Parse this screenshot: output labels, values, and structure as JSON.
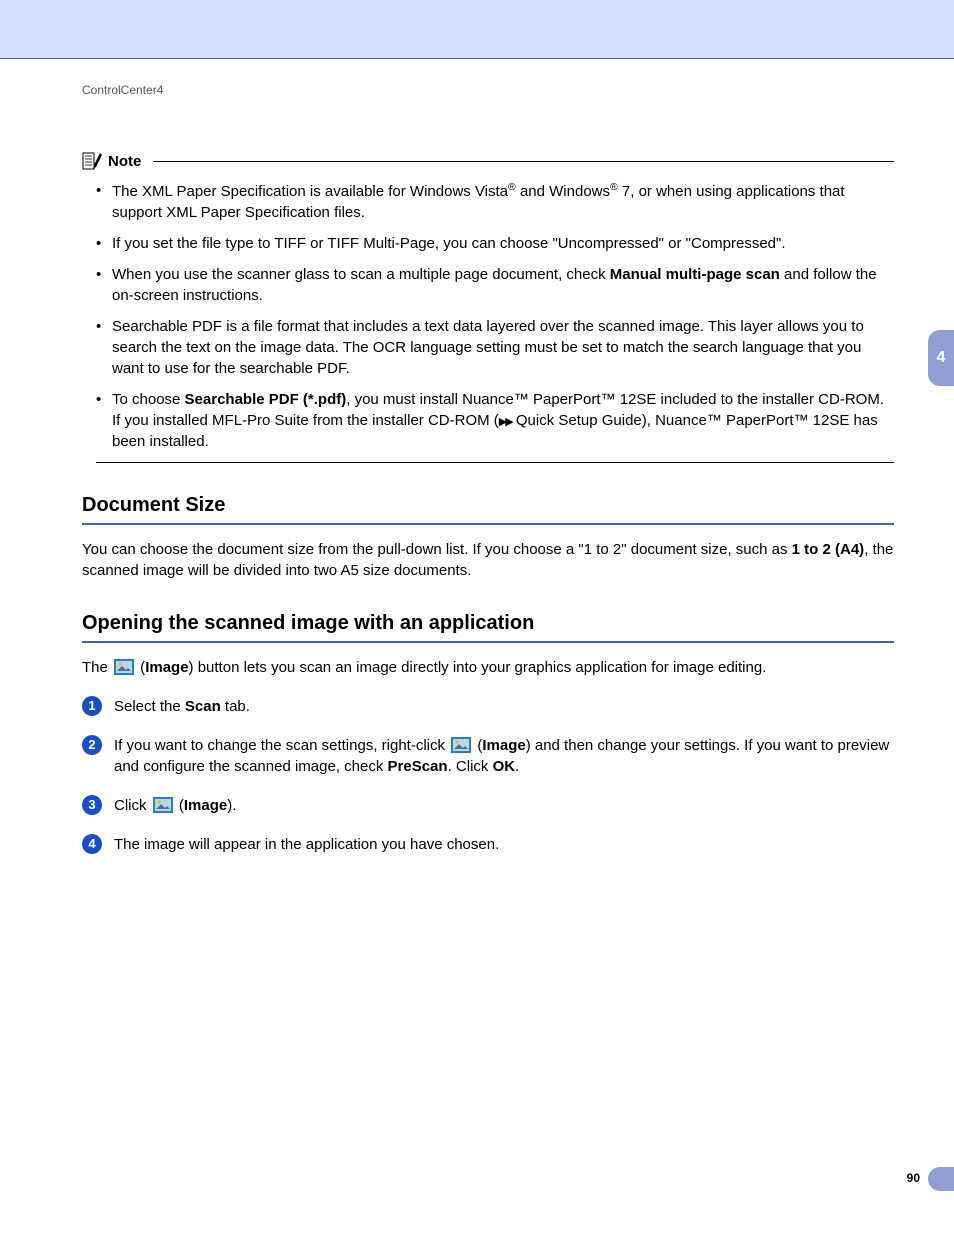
{
  "running_header": "ControlCenter4",
  "side_tab": "4",
  "page_number": "90",
  "note": {
    "label": "Note",
    "items": [
      {
        "parts": [
          "The XML Paper Specification is available for Windows Vista",
          "®",
          " and Windows",
          "®",
          " 7, or when using applications that support XML Paper Specification files."
        ]
      },
      {
        "parts": [
          "If you set the file type to TIFF or TIFF Multi-Page, you can choose \"Uncompressed\" or \"Compressed\"."
        ]
      },
      {
        "parts": [
          "When you use the scanner glass to scan a multiple page document, check ",
          {
            "bold": "Manual multi-page scan"
          },
          " and follow the on-screen instructions."
        ]
      },
      {
        "parts": [
          "Searchable PDF is a file format that includes a text data layered over the scanned image. This layer allows you to search the text on the image data. The OCR language setting must be set to match the search language that you want to use for the searchable PDF."
        ]
      },
      {
        "parts": [
          "To choose ",
          {
            "bold": "Searchable PDF (*.pdf)"
          },
          ", you must install  Nuance™ PaperPort™ 12SE included to the installer CD-ROM. If you installed MFL-Pro Suite from the installer CD-ROM (",
          {
            "arrows": true
          },
          " Quick Setup Guide), Nuance™ PaperPort™ 12SE has been installed."
        ]
      }
    ]
  },
  "section1": {
    "title": "Document Size",
    "paragraph_parts": [
      "You can choose the document size from the pull-down list. If you choose a \"1 to 2\" document size, such as ",
      {
        "bold": "1 to 2 (A4)"
      },
      ", the scanned image will be divided into two A5 size documents."
    ]
  },
  "section2": {
    "title": "Opening the scanned image with an application",
    "intro_parts": [
      "The ",
      {
        "icon": true
      },
      " (",
      {
        "bold": "Image"
      },
      ") button lets you scan an image directly into your graphics application for image editing."
    ],
    "steps": [
      {
        "num": "1",
        "parts": [
          "Select the ",
          {
            "bold": "Scan"
          },
          " tab."
        ]
      },
      {
        "num": "2",
        "parts": [
          "If you want to change the scan settings, right-click ",
          {
            "icon": true
          },
          " (",
          {
            "bold": "Image"
          },
          ") and then change your settings. If you want to preview and configure the scanned image, check ",
          {
            "bold": "PreScan"
          },
          ". Click ",
          {
            "bold": "OK"
          },
          "."
        ]
      },
      {
        "num": "3",
        "parts": [
          "Click ",
          {
            "icon": true
          },
          " (",
          {
            "bold": "Image"
          },
          ")."
        ]
      },
      {
        "num": "4",
        "parts": [
          "The image will appear in the application you have chosen."
        ]
      }
    ]
  }
}
